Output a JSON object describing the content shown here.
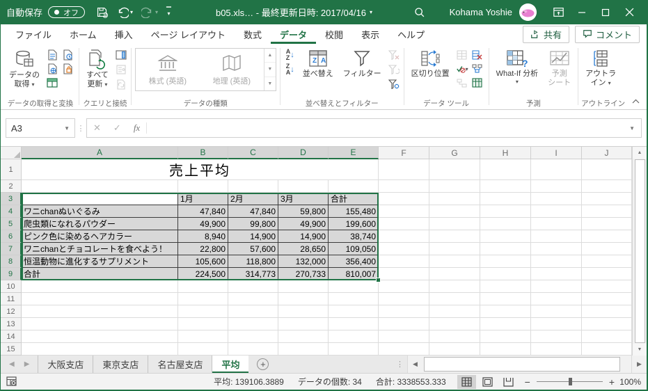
{
  "colors": {
    "accent": "#217346",
    "selection_fill": "#d8d8d8"
  },
  "titlebar": {
    "autosave_label": "自動保存",
    "autosave_state": "オフ",
    "doc_title": "b05.xls…  -  最終更新日時: 2017/04/16",
    "user_name": "Kohama Yoshie"
  },
  "tabs": {
    "items": [
      "ファイル",
      "ホーム",
      "挿入",
      "ページ レイアウト",
      "数式",
      "データ",
      "校閲",
      "表示",
      "ヘルプ"
    ],
    "active": "データ",
    "share": "共有",
    "comments": "コメント"
  },
  "ribbon": {
    "groups": {
      "get_transform": "データの取得と変換",
      "queries": "クエリと接続",
      "types": "データの種類",
      "sortfilter": "並べ替えとフィルター",
      "tools": "データ ツール",
      "forecast": "予測",
      "outline": "アウトライン"
    },
    "get_data_line1": "データの",
    "get_data_line2": "取得",
    "refresh_line1": "すべて",
    "refresh_line2": "更新",
    "stocks": "株式 (英語)",
    "geography": "地理 (英語)",
    "sort": "並べ替え",
    "filter": "フィルター",
    "text_to_columns": "区切り位置",
    "whatif": "What-If 分析",
    "forecast_line1": "予測",
    "forecast_line2": "シート",
    "outline_line1": "アウトラ",
    "outline_line2": "イン"
  },
  "formula_bar": {
    "name_box": "A3",
    "fx": "fx"
  },
  "grid": {
    "columns": [
      "A",
      "B",
      "C",
      "D",
      "E",
      "F",
      "G",
      "H",
      "I",
      "J"
    ],
    "selected_columns": [
      0,
      1,
      2,
      3,
      4
    ],
    "selected_rows": [
      3,
      4,
      5,
      6,
      7,
      8,
      9
    ],
    "row_count": 15,
    "title": "売上平均",
    "table": {
      "header": [
        "",
        "1月",
        "2月",
        "3月",
        "合計"
      ],
      "rows": [
        [
          "ワニchanぬいぐるみ",
          "47,840",
          "47,840",
          "59,800",
          "155,480"
        ],
        [
          "爬虫類になれるパウダー",
          "49,900",
          "99,800",
          "49,900",
          "199,600"
        ],
        [
          "ピンク色に染めるヘアカラー",
          "8,940",
          "14,900",
          "14,900",
          "38,740"
        ],
        [
          "ワニchanとチョコレートを食べよう！",
          "22,800",
          "57,600",
          "28,650",
          "109,050"
        ],
        [
          "恒温動物に進化するサプリメント",
          "105,600",
          "118,800",
          "132,000",
          "356,400"
        ],
        [
          "合計",
          "224,500",
          "314,773",
          "270,733",
          "810,007"
        ]
      ]
    }
  },
  "sheet_tabs": {
    "items": [
      "大阪支店",
      "東京支店",
      "名古屋支店",
      "平均"
    ],
    "active": "平均"
  },
  "status_bar": {
    "average": "平均: 139106.3889",
    "count": "データの個数: 34",
    "sum": "合計: 3338553.333",
    "zoom_level": "100%"
  }
}
